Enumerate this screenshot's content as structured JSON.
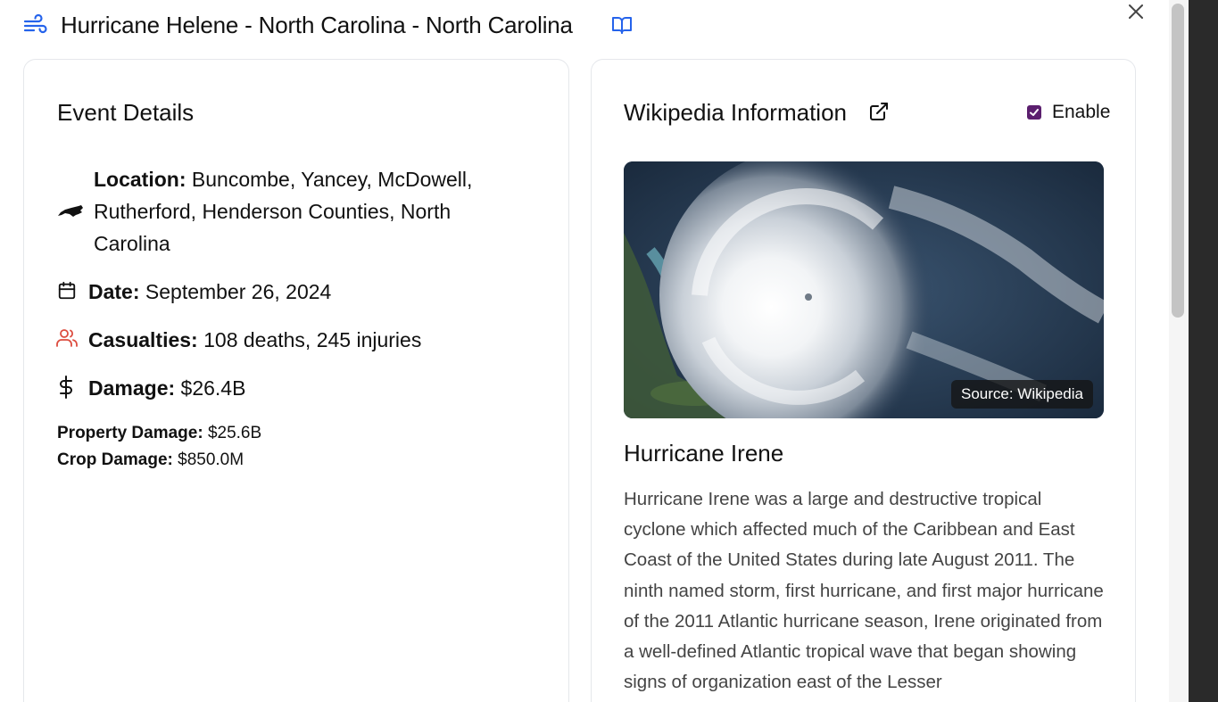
{
  "header": {
    "title": "Hurricane Helene - North Carolina - North Carolina",
    "title_icon": "wind-icon",
    "book_icon": "book-open-icon",
    "close_icon": "close-icon"
  },
  "event_details": {
    "title": "Event Details",
    "location_label": "Location:",
    "location_value": "Buncombe, Yancey, McDowell, Rutherford, Henderson Counties, North Carolina",
    "location_icon": "north-carolina-state-icon",
    "date_label": "Date:",
    "date_value": "September 26, 2024",
    "date_icon": "calendar-icon",
    "casualties_label": "Casualties:",
    "casualties_value": "108 deaths, 245 injuries",
    "casualties_icon": "users-icon",
    "damage_label": "Damage:",
    "damage_value": "$26.4B",
    "damage_icon": "dollar-icon",
    "property_damage_label": "Property Damage:",
    "property_damage_value": "$25.6B",
    "crop_damage_label": "Crop Damage:",
    "crop_damage_value": "$850.0M"
  },
  "wikipedia": {
    "title": "Wikipedia Information",
    "external_link_icon": "external-link-icon",
    "enable_label": "Enable",
    "enable_checked": true,
    "image_source_label": "Source: Wikipedia",
    "article_title": "Hurricane Irene",
    "article_text": "Hurricane Irene was a large and destructive tropical cyclone which affected much of the Caribbean and East Coast of the United States during late August 2011. The ninth named storm, first hurricane, and first major hurricane of the 2011 Atlantic hurricane season, Irene originated from a well-defined Atlantic tropical wave that began showing signs of organization east of the Lesser"
  },
  "colors": {
    "accent_blue": "#2563eb",
    "casualties_red": "#dc4c3f",
    "checkbox_purple": "#5b1f6e",
    "body_text_gray": "#444444"
  }
}
